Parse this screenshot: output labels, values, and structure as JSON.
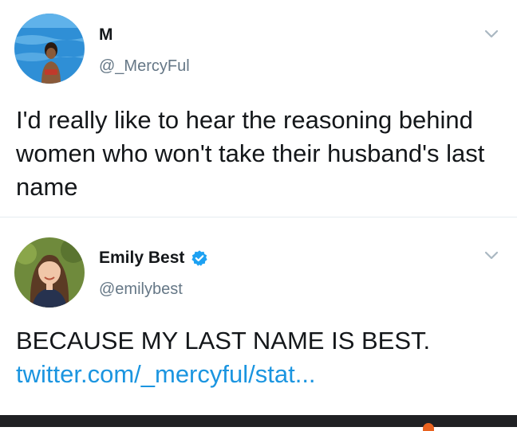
{
  "tweets": [
    {
      "name": "M",
      "handle": "@_MercyFul",
      "text": "I'd really like to hear the reasoning behind women who won't take their husband's last name",
      "avatar_icon": "avatar-photo-beach",
      "menu_icon": "chevron-down-icon"
    },
    {
      "name": "Emily Best",
      "verified": true,
      "handle": "@emilybest",
      "text": "BECAUSE MY LAST NAME IS BEST.",
      "link": "twitter.com/_mercyful/stat...",
      "avatar_icon": "avatar-photo-portrait",
      "menu_icon": "chevron-down-icon"
    }
  ],
  "colors": {
    "text": "#14171a",
    "handle": "#657786",
    "link": "#1b95e0",
    "verified": "#1da1f2",
    "divider": "#e6ecf0"
  }
}
